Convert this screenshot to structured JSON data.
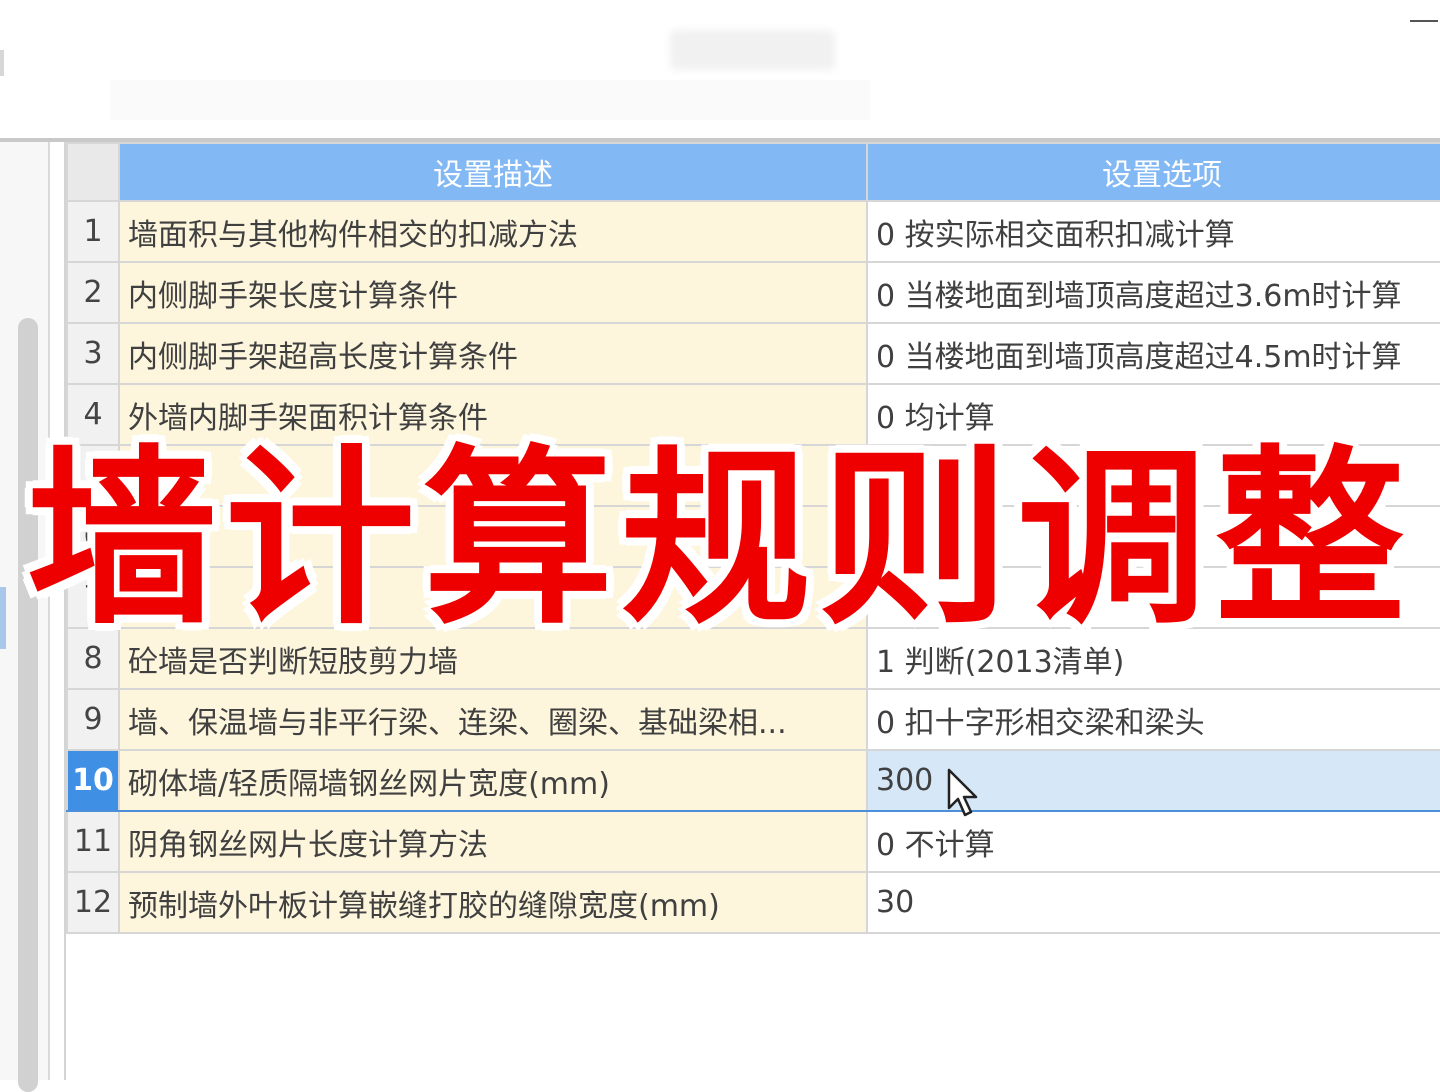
{
  "table": {
    "header": {
      "desc": "设置描述",
      "option": "设置选项"
    },
    "rows": [
      {
        "num": "1",
        "desc": "墙面积与其他构件相交的扣减方法",
        "option": "0 按实际相交面积扣减计算"
      },
      {
        "num": "2",
        "desc": "内侧脚手架长度计算条件",
        "option": "0 当楼地面到墙顶高度超过3.6m时计算"
      },
      {
        "num": "3",
        "desc": "内侧脚手架超高长度计算条件",
        "option": "0 当楼地面到墙顶高度超过4.5m时计算"
      },
      {
        "num": "4",
        "desc": "外墙内脚手架面积计算条件",
        "option": "0 均计算"
      },
      {
        "num": "5",
        "desc": "",
        "option": ""
      },
      {
        "num": "6",
        "desc": "",
        "option": ""
      },
      {
        "num": "7",
        "desc": "",
        "option": ""
      },
      {
        "num": "8",
        "desc": "砼墙是否判断短肢剪力墙",
        "option": "1 判断(2013清单)"
      },
      {
        "num": "9",
        "desc": "墙、保温墙与非平行梁、连梁、圈梁、基础梁相...",
        "option": "0 扣十字形相交梁和梁头"
      },
      {
        "num": "10",
        "desc": "砌体墙/轻质隔墙钢丝网片宽度(mm)",
        "option": "300"
      },
      {
        "num": "11",
        "desc": "阴角钢丝网片长度计算方法",
        "option": "0 不计算"
      },
      {
        "num": "12",
        "desc": "预制墙外叶板计算嵌缝打胶的缝隙宽度(mm)",
        "option": "30"
      }
    ]
  },
  "overlay": {
    "title": "墙计算规则调整",
    "color": "#ee0000"
  },
  "colors": {
    "header_bg": "#82b8f4",
    "desc_bg": "#fdf6dd",
    "selected_num_bg": "#3f8fe4",
    "selected_row_bg": "#d6e7f8"
  },
  "icons": {
    "cursor": "mouse-pointer-icon",
    "minimize": "minimize-icon"
  }
}
